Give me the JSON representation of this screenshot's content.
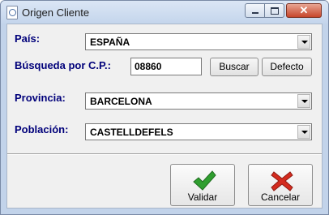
{
  "window": {
    "title": "Origen Cliente"
  },
  "titlebar_icons": {
    "app": "document-icon",
    "minimize": "minimize-icon",
    "maximize": "maximize-icon",
    "close": "close-icon"
  },
  "form": {
    "pais": {
      "label": "País:",
      "value": "ESPAÑA"
    },
    "busqueda": {
      "label": "Búsqueda por C.P.:",
      "value": "08860",
      "buscar_label": "Buscar",
      "defecto_label": "Defecto"
    },
    "provincia": {
      "label": "Provincia:",
      "value": "BARCELONA"
    },
    "poblacion": {
      "label": "Población:",
      "value": "CASTELLDEFELS"
    }
  },
  "actions": {
    "validar": {
      "label": "Validar",
      "icon": "checkmark-icon",
      "color": "#2f9e2f"
    },
    "cancelar": {
      "label": "Cancelar",
      "icon": "x-icon",
      "color": "#d42b1e"
    }
  }
}
